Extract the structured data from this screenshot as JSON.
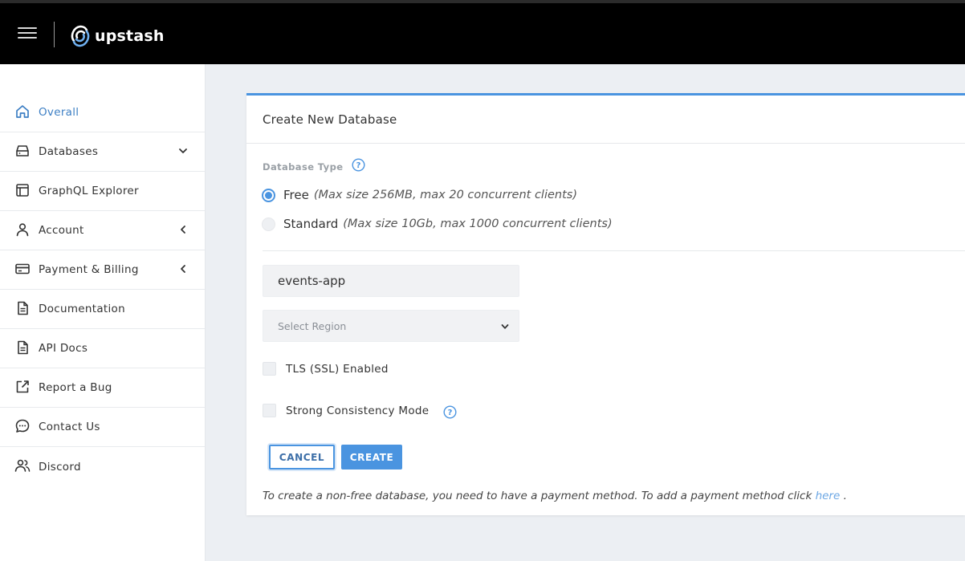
{
  "app": {
    "brand": "upstash"
  },
  "sidebar": {
    "items": [
      {
        "label": "Overall",
        "icon": "home-icon",
        "active": true,
        "caret": ""
      },
      {
        "label": "Databases",
        "icon": "database-icon",
        "active": false,
        "caret": "chevron-down-icon"
      },
      {
        "label": "GraphQL Explorer",
        "icon": "browser-window-icon",
        "active": false,
        "caret": ""
      },
      {
        "label": "Account",
        "icon": "user-icon",
        "active": false,
        "caret": "chevron-left-icon"
      },
      {
        "label": "Payment & Billing",
        "icon": "credit-card-icon",
        "active": false,
        "caret": "chevron-left-icon"
      },
      {
        "label": "Documentation",
        "icon": "document-icon",
        "active": false,
        "caret": ""
      },
      {
        "label": "API Docs",
        "icon": "document-icon",
        "active": false,
        "caret": ""
      },
      {
        "label": "Report a Bug",
        "icon": "external-link-icon",
        "active": false,
        "caret": ""
      },
      {
        "label": "Contact Us",
        "icon": "chat-bubble-icon",
        "active": false,
        "caret": ""
      },
      {
        "label": "Discord",
        "icon": "users-icon",
        "active": false,
        "caret": ""
      }
    ]
  },
  "form": {
    "title": "Create New Database",
    "database_type_label": "Database Type",
    "options": [
      {
        "name": "Free",
        "description": "(Max size 256MB, max 20 concurrent clients)",
        "selected": true
      },
      {
        "name": "Standard",
        "description": "(Max size 10Gb, max 1000 concurrent clients)",
        "selected": false
      }
    ],
    "name_value": "events-app",
    "region_placeholder": "Select Region",
    "tls_label": "TLS (SSL) Enabled",
    "tls_checked": false,
    "consistency_label": "Strong Consistency Mode",
    "consistency_checked": false,
    "cancel_label": "CANCEL",
    "create_label": "CREATE",
    "footnote_text": "To create a non-free database, you need to have a payment method. To add a payment method click ",
    "footnote_link": "here",
    "footnote_end": " ."
  },
  "colors": {
    "accent": "#4a94e0",
    "topbar": "#000000",
    "background": "#eceff3",
    "active_nav": "#3d7fc4"
  }
}
